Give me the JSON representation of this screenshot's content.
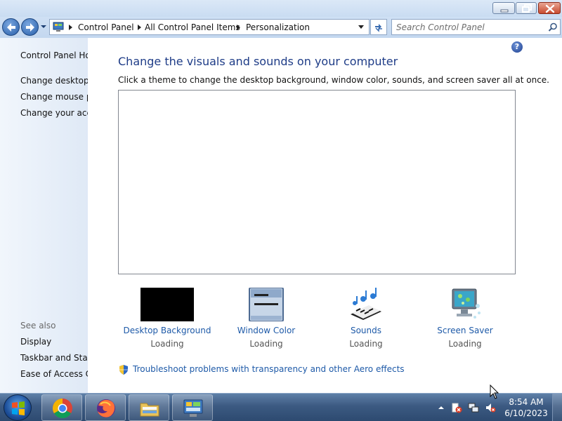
{
  "window": {
    "buttons": {
      "minimize": "minimize-icon",
      "maximize": "restore-icon",
      "close": "close-icon"
    }
  },
  "address_bar": {
    "breadcrumbs": [
      "Control Panel",
      "All Control Panel Items",
      "Personalization"
    ]
  },
  "search": {
    "placeholder": "Search Control Panel"
  },
  "left_pane": {
    "links": [
      "Control Panel Home",
      "Change desktop icons",
      "Change mouse pointers",
      "Change your account picture"
    ],
    "see_also_title": "See also",
    "see_also_links": [
      "Display",
      "Taskbar and Start Menu",
      "Ease of Access Center"
    ]
  },
  "main": {
    "heading": "Change the visuals and sounds on your computer",
    "subtext": "Click a theme to change the desktop background, window color, sounds, and screen saver all at once.",
    "settings": [
      {
        "label": "Desktop Background",
        "status": "Loading",
        "icon": "desktop-background-icon"
      },
      {
        "label": "Window Color",
        "status": "Loading",
        "icon": "window-color-icon"
      },
      {
        "label": "Sounds",
        "status": "Loading",
        "icon": "sounds-icon"
      },
      {
        "label": "Screen Saver",
        "status": "Loading",
        "icon": "screen-saver-icon"
      }
    ],
    "troubleshoot_link": "Troubleshoot problems with transparency and other Aero effects"
  },
  "taskbar": {
    "pinned": [
      "chrome-icon",
      "firefox-icon",
      "file-explorer-icon",
      "control-panel-icon"
    ],
    "clock": {
      "time": "8:54 AM",
      "date": "6/10/2023"
    }
  },
  "colors": {
    "link": "#1e5aa8",
    "heading": "#1e3c87",
    "taskbar": "#3c5a82"
  }
}
